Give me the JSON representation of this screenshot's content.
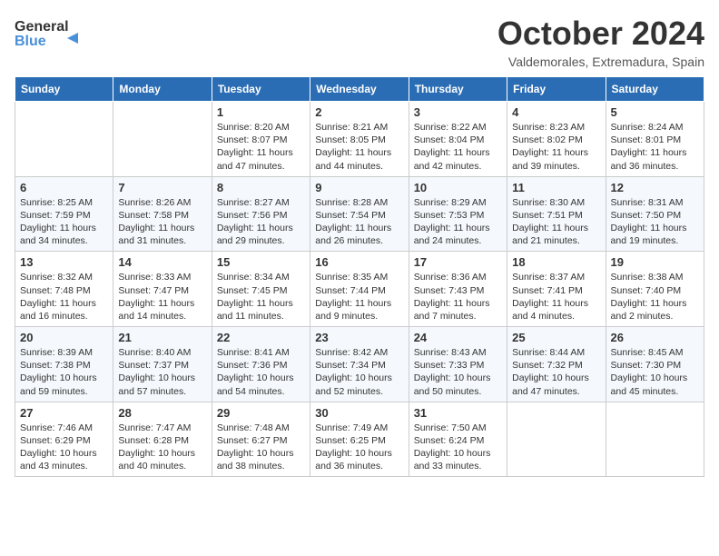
{
  "logo": {
    "line1": "General",
    "line2": "Blue"
  },
  "title": "October 2024",
  "subtitle": "Valdemorales, Extremadura, Spain",
  "weekdays": [
    "Sunday",
    "Monday",
    "Tuesday",
    "Wednesday",
    "Thursday",
    "Friday",
    "Saturday"
  ],
  "weeks": [
    [
      {
        "day": "",
        "info": ""
      },
      {
        "day": "",
        "info": ""
      },
      {
        "day": "1",
        "info": "Sunrise: 8:20 AM\nSunset: 8:07 PM\nDaylight: 11 hours and 47 minutes."
      },
      {
        "day": "2",
        "info": "Sunrise: 8:21 AM\nSunset: 8:05 PM\nDaylight: 11 hours and 44 minutes."
      },
      {
        "day": "3",
        "info": "Sunrise: 8:22 AM\nSunset: 8:04 PM\nDaylight: 11 hours and 42 minutes."
      },
      {
        "day": "4",
        "info": "Sunrise: 8:23 AM\nSunset: 8:02 PM\nDaylight: 11 hours and 39 minutes."
      },
      {
        "day": "5",
        "info": "Sunrise: 8:24 AM\nSunset: 8:01 PM\nDaylight: 11 hours and 36 minutes."
      }
    ],
    [
      {
        "day": "6",
        "info": "Sunrise: 8:25 AM\nSunset: 7:59 PM\nDaylight: 11 hours and 34 minutes."
      },
      {
        "day": "7",
        "info": "Sunrise: 8:26 AM\nSunset: 7:58 PM\nDaylight: 11 hours and 31 minutes."
      },
      {
        "day": "8",
        "info": "Sunrise: 8:27 AM\nSunset: 7:56 PM\nDaylight: 11 hours and 29 minutes."
      },
      {
        "day": "9",
        "info": "Sunrise: 8:28 AM\nSunset: 7:54 PM\nDaylight: 11 hours and 26 minutes."
      },
      {
        "day": "10",
        "info": "Sunrise: 8:29 AM\nSunset: 7:53 PM\nDaylight: 11 hours and 24 minutes."
      },
      {
        "day": "11",
        "info": "Sunrise: 8:30 AM\nSunset: 7:51 PM\nDaylight: 11 hours and 21 minutes."
      },
      {
        "day": "12",
        "info": "Sunrise: 8:31 AM\nSunset: 7:50 PM\nDaylight: 11 hours and 19 minutes."
      }
    ],
    [
      {
        "day": "13",
        "info": "Sunrise: 8:32 AM\nSunset: 7:48 PM\nDaylight: 11 hours and 16 minutes."
      },
      {
        "day": "14",
        "info": "Sunrise: 8:33 AM\nSunset: 7:47 PM\nDaylight: 11 hours and 14 minutes."
      },
      {
        "day": "15",
        "info": "Sunrise: 8:34 AM\nSunset: 7:45 PM\nDaylight: 11 hours and 11 minutes."
      },
      {
        "day": "16",
        "info": "Sunrise: 8:35 AM\nSunset: 7:44 PM\nDaylight: 11 hours and 9 minutes."
      },
      {
        "day": "17",
        "info": "Sunrise: 8:36 AM\nSunset: 7:43 PM\nDaylight: 11 hours and 7 minutes."
      },
      {
        "day": "18",
        "info": "Sunrise: 8:37 AM\nSunset: 7:41 PM\nDaylight: 11 hours and 4 minutes."
      },
      {
        "day": "19",
        "info": "Sunrise: 8:38 AM\nSunset: 7:40 PM\nDaylight: 11 hours and 2 minutes."
      }
    ],
    [
      {
        "day": "20",
        "info": "Sunrise: 8:39 AM\nSunset: 7:38 PM\nDaylight: 10 hours and 59 minutes."
      },
      {
        "day": "21",
        "info": "Sunrise: 8:40 AM\nSunset: 7:37 PM\nDaylight: 10 hours and 57 minutes."
      },
      {
        "day": "22",
        "info": "Sunrise: 8:41 AM\nSunset: 7:36 PM\nDaylight: 10 hours and 54 minutes."
      },
      {
        "day": "23",
        "info": "Sunrise: 8:42 AM\nSunset: 7:34 PM\nDaylight: 10 hours and 52 minutes."
      },
      {
        "day": "24",
        "info": "Sunrise: 8:43 AM\nSunset: 7:33 PM\nDaylight: 10 hours and 50 minutes."
      },
      {
        "day": "25",
        "info": "Sunrise: 8:44 AM\nSunset: 7:32 PM\nDaylight: 10 hours and 47 minutes."
      },
      {
        "day": "26",
        "info": "Sunrise: 8:45 AM\nSunset: 7:30 PM\nDaylight: 10 hours and 45 minutes."
      }
    ],
    [
      {
        "day": "27",
        "info": "Sunrise: 7:46 AM\nSunset: 6:29 PM\nDaylight: 10 hours and 43 minutes."
      },
      {
        "day": "28",
        "info": "Sunrise: 7:47 AM\nSunset: 6:28 PM\nDaylight: 10 hours and 40 minutes."
      },
      {
        "day": "29",
        "info": "Sunrise: 7:48 AM\nSunset: 6:27 PM\nDaylight: 10 hours and 38 minutes."
      },
      {
        "day": "30",
        "info": "Sunrise: 7:49 AM\nSunset: 6:25 PM\nDaylight: 10 hours and 36 minutes."
      },
      {
        "day": "31",
        "info": "Sunrise: 7:50 AM\nSunset: 6:24 PM\nDaylight: 10 hours and 33 minutes."
      },
      {
        "day": "",
        "info": ""
      },
      {
        "day": "",
        "info": ""
      }
    ]
  ]
}
